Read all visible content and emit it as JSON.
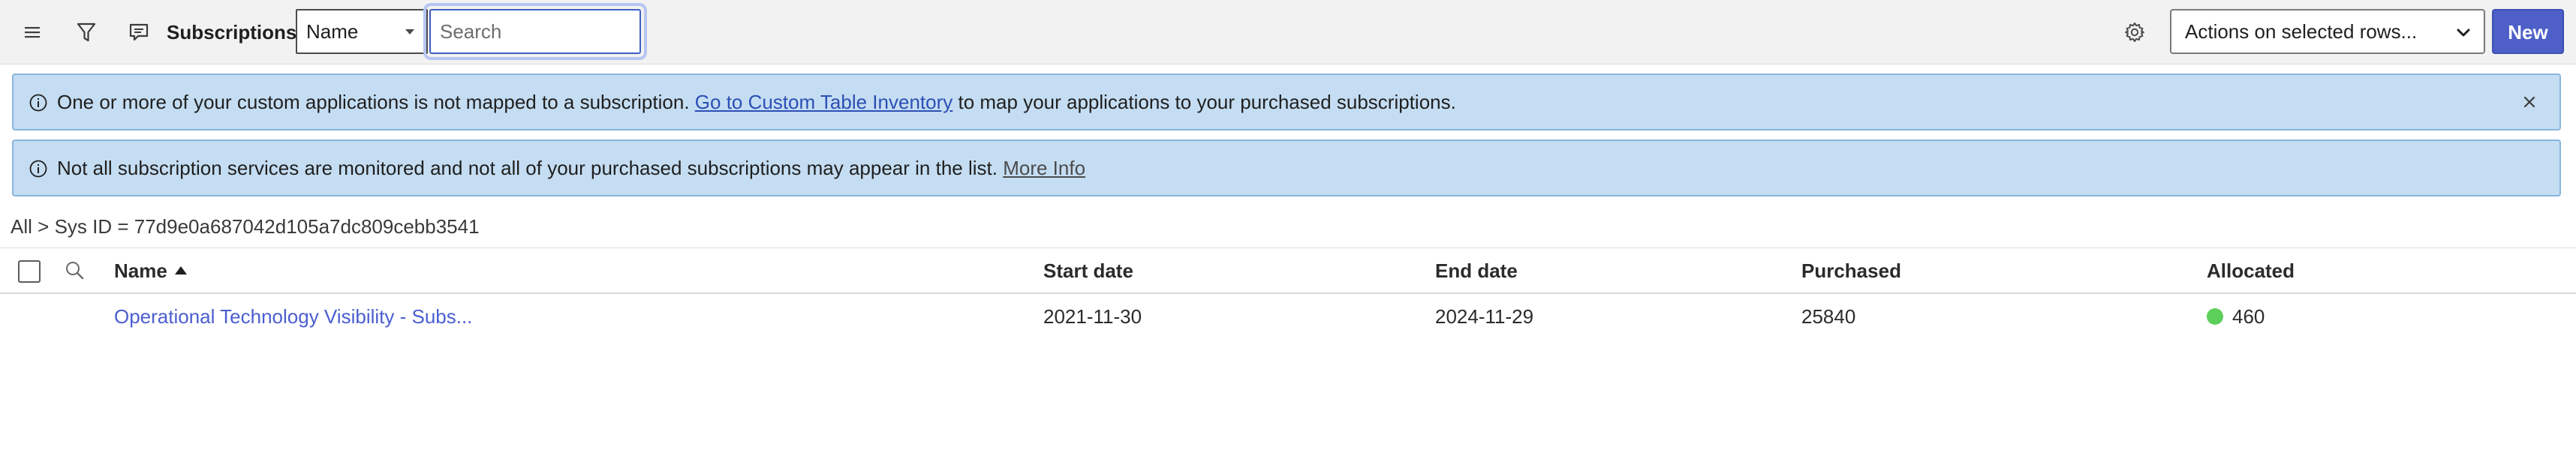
{
  "header": {
    "title": "Subscriptions",
    "field_select_value": "Name",
    "search_placeholder": "Search",
    "actions_value": "Actions on selected rows...",
    "new_label": "New",
    "icons": [
      "menu-icon",
      "filter-icon",
      "chat-icon",
      "gear-icon"
    ]
  },
  "banners": [
    {
      "text_before": "One or more of your custom applications is not mapped to a subscription.",
      "link": "Go to Custom Table Inventory",
      "text_after": " to map your applications to your purchased subscriptions."
    },
    {
      "text_before": "Not all subscription services are monitored and not all of your purchased subscriptions may appear in the list.",
      "link": "More Info"
    }
  ],
  "breadcrumb": {
    "all": "All",
    "separator": ">",
    "filter": "Sys ID = 77d9e0a687042d105a7dc809cebb3541"
  },
  "table": {
    "columns": [
      "Name",
      "Start date",
      "End date",
      "Purchased",
      "Allocated"
    ],
    "rows": [
      {
        "name": "Operational Technology Visibility - Subs...",
        "start_date": "2021-11-30",
        "end_date": "2024-11-29",
        "purchased": "25840",
        "allocated": "460",
        "status_color": "#5ccf5a"
      }
    ]
  },
  "colors": {
    "accent": "#4e5fc8",
    "banner_bg": "#c5ddf2",
    "link": "#2b4fb5",
    "row_link": "#4a5ed0"
  }
}
